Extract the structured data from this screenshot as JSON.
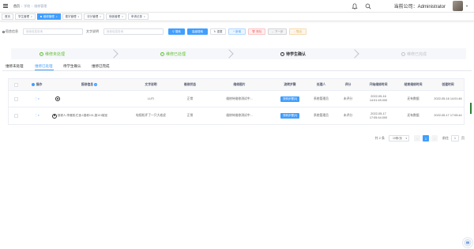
{
  "breadcrumb": {
    "items": [
      "首页",
      "学校",
      "维修管理"
    ]
  },
  "header": {
    "company_label": "当前公司：Administrator"
  },
  "tags_view": [
    {
      "label": "首页",
      "active": false
    },
    {
      "label": "学生管理",
      "active": false
    },
    {
      "label": "维修管理",
      "active": true
    },
    {
      "label": "楼宇管理",
      "active": false
    },
    {
      "label": "评分管理",
      "active": false
    },
    {
      "label": "宿舍管理",
      "active": false
    },
    {
      "label": "申请记录",
      "active": false
    }
  ],
  "filters": {
    "dorm_label": "宿舍信息",
    "dorm_placeholder": "宿舍信息查询",
    "desc_label": "文字说明",
    "desc_placeholder": "宿舍信息查询",
    "search": "搜索",
    "advanced": "高级搜索",
    "reset": "重置",
    "add": "新增",
    "delete": "删除",
    "next": "下一步",
    "extra": "导出"
  },
  "steps": [
    {
      "label": "维修未处理",
      "state": "done"
    },
    {
      "label": "维修已处理",
      "state": "done"
    },
    {
      "label": "待学生确认",
      "state": "current"
    },
    {
      "label": "维修已完成",
      "state": "wait"
    }
  ],
  "subtabs": [
    "维修未处理",
    "维修已处理",
    "待学生确认",
    "维修已完成"
  ],
  "table": {
    "columns": [
      "操作",
      "报修信息",
      "文字说明",
      "维修状态",
      "维修图片",
      "流转步骤",
      "处理人",
      "评分",
      "开始维修时间",
      "结束维修时间",
      "创建时间"
    ],
    "rows": [
      {
        "op": "⋮",
        "info": "",
        "desc": "LUTI",
        "status": "正常",
        "image": "维修待维修测试中...",
        "step_btn": "流转步骤(3)",
        "handler": "系统管理员",
        "score": "未评分",
        "start": "2022-05-16 14:01:49.000",
        "end": "还有数据",
        "created": "2022-05-16 14:01:46"
      },
      {
        "op": "⋮",
        "info": "报修人:李雅丽,栏舍:1楼栋101,报101寝室",
        "desc": "电视机坏了一只大老虎",
        "status": "正常",
        "image": "维修待维修测试中...",
        "step_btn": "流转步骤(3)",
        "handler": "系统管理员",
        "score": "未评分",
        "start": "2022-05-17 17:05:44.000",
        "end": "还有数据",
        "created": "2022-05-17 17:05:44"
      }
    ]
  },
  "pagination": {
    "total": "共 2 条",
    "page_size": "10条/页",
    "current": "1",
    "goto_label": "前往",
    "goto_value": "1",
    "page_suffix": "页"
  },
  "colors": {
    "primary": "#409eff",
    "success": "#67c23a",
    "danger": "#f56c6c",
    "warning": "#e6a23c"
  }
}
